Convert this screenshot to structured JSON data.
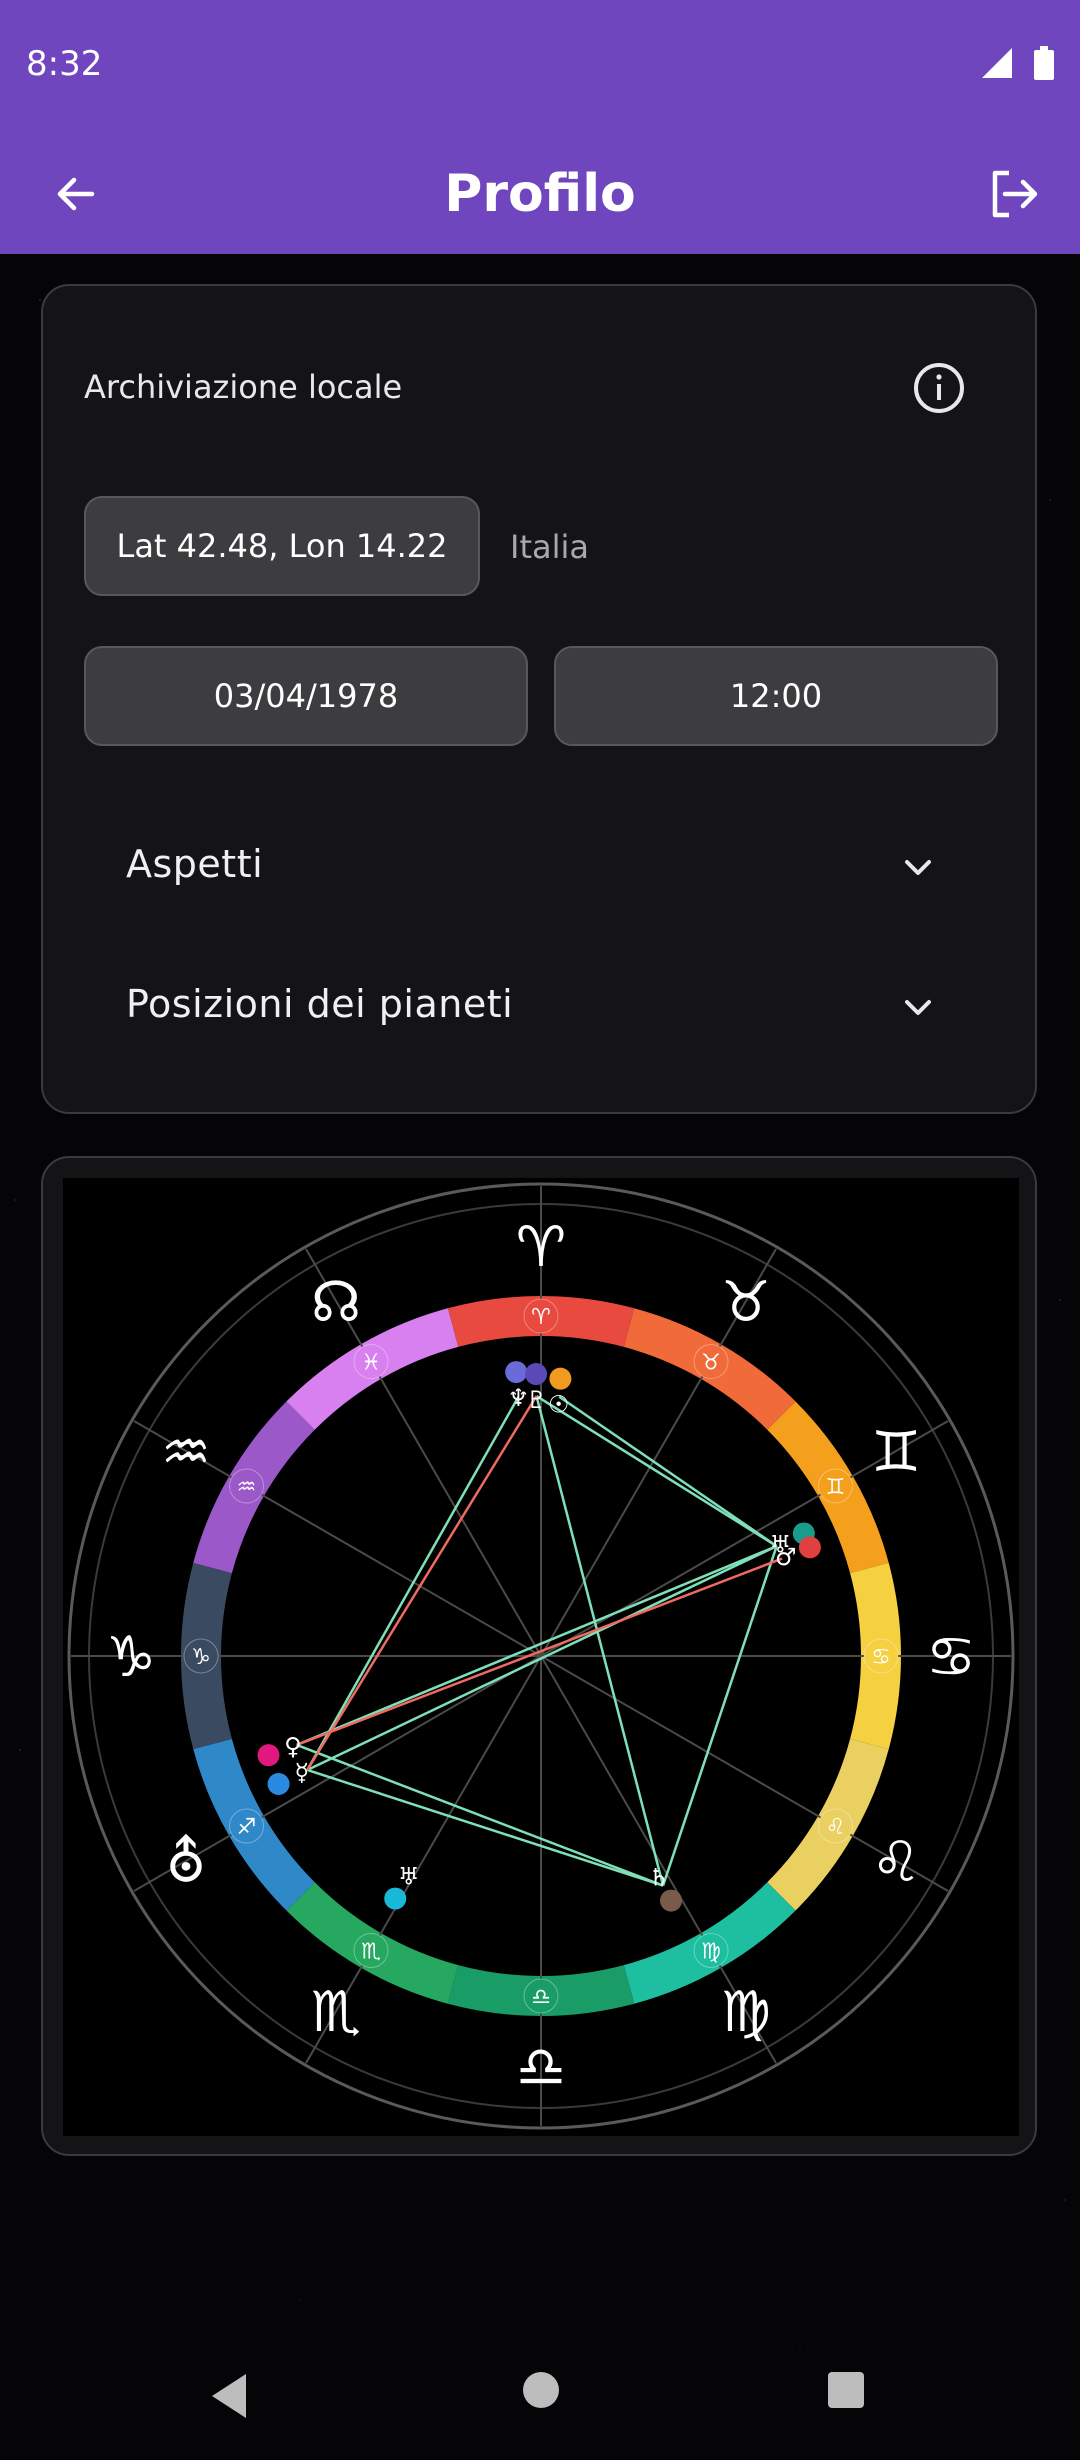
{
  "status": {
    "time": "8:32"
  },
  "appbar": {
    "title": "Profilo"
  },
  "profile": {
    "storage_label": "Archiviazione locale",
    "coords": "Lat 42.48, Lon 14.22",
    "country": "Italia",
    "date": "03/04/1978",
    "time": "12:00"
  },
  "sections": {
    "aspects": "Aspetti",
    "positions": "Posizioni dei pianeti"
  },
  "chart": {
    "signs": [
      {
        "glyph": "♈",
        "name": "aries",
        "color": "#e84a40"
      },
      {
        "glyph": "♉",
        "name": "taurus",
        "color": "#f06a3a"
      },
      {
        "glyph": "♊",
        "name": "gemini",
        "color": "#f5a01d"
      },
      {
        "glyph": "♋",
        "name": "cancer",
        "color": "#f5d040"
      },
      {
        "glyph": "♌",
        "name": "leo",
        "color": "#ead060"
      },
      {
        "glyph": "♍",
        "name": "virgo",
        "color": "#1ebfa0"
      },
      {
        "glyph": "♎",
        "name": "libra",
        "color": "#1a9c66"
      },
      {
        "glyph": "♏",
        "name": "scorpio",
        "color": "#27a860"
      },
      {
        "glyph": "♐",
        "name": "sagittarius",
        "color": "#2f88c8"
      },
      {
        "glyph": "♑",
        "name": "capricorn",
        "color": "#3a4a60"
      },
      {
        "glyph": "♒",
        "name": "aquarius",
        "color": "#9b58c8"
      },
      {
        "glyph": "♓",
        "name": "pisces",
        "color": "#d880f0"
      }
    ],
    "outer_glyphs": [
      "♈",
      "♉",
      "♊",
      "♋",
      "♌",
      "♍",
      "♎",
      "♏",
      "⛢",
      "♑",
      "♒",
      "☊"
    ],
    "planets": [
      {
        "glyph": "♆",
        "name": "neptune",
        "color": "#6a6ad8"
      },
      {
        "glyph": "♇",
        "name": "pluto",
        "color": "#5a4ab8"
      },
      {
        "glyph": "☉",
        "name": "sun",
        "color": "#f09a20"
      },
      {
        "glyph": "♅",
        "name": "uranus",
        "color": "#1a9c8c"
      },
      {
        "glyph": "♂",
        "name": "mars",
        "color": "#e04040"
      },
      {
        "glyph": "♄",
        "name": "saturn",
        "color": "#7a5a4a"
      },
      {
        "glyph": "♅",
        "name": "uranus-2",
        "color": "#18b8d8"
      },
      {
        "glyph": "☿",
        "name": "mercury",
        "color": "#2a8ae0"
      },
      {
        "glyph": "♀",
        "name": "venus",
        "color": "#e01880"
      }
    ],
    "colors": {
      "harmonic": "#7fe0b8",
      "tension": "#f06a60",
      "grid": "#4a4a4a"
    }
  }
}
